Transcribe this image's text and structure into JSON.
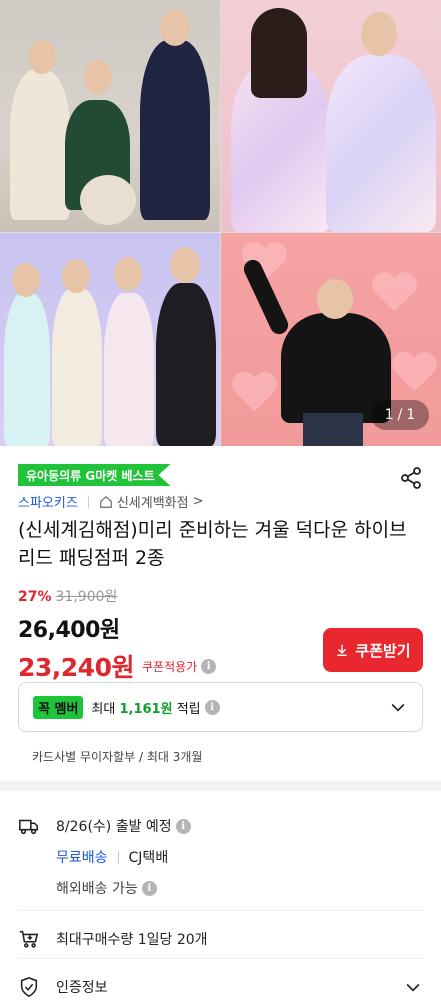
{
  "gallery": {
    "page_indicator": {
      "current": "1",
      "separator": "/",
      "total": "1"
    }
  },
  "badge": {
    "label": "유아동의류 G마켓 베스트"
  },
  "brand": {
    "name": "스파오키즈",
    "store": "신세계백화점",
    "store_arrow": ">"
  },
  "product": {
    "title": "(신세계김해점)미리 준비하는 겨울 덕다운 하이브리드 패딩점퍼 2종"
  },
  "price": {
    "discount": "27%",
    "original": "31,900원",
    "sale": "26,400원",
    "coupon_price": "23,240원",
    "coupon_label": "쿠폰적용가",
    "coupon_button": "쿠폰받기"
  },
  "member": {
    "badge": "꼭 멤버",
    "text_prefix": "최대 ",
    "amount": "1,161원",
    "text_suffix": " 적립"
  },
  "installment": {
    "text": "카드사별 무이자할부 / 최대 3개월"
  },
  "shipping": {
    "date": "8/26(수) 출발 예정",
    "free": "무료배송",
    "carrier": "CJ택배",
    "overseas": "해외배송 가능"
  },
  "purchase": {
    "max": "최대구매수량 1일당 20개"
  },
  "certification": {
    "label": "인증정보"
  },
  "colors": {
    "accent_red": "#e8272f",
    "brand_blue": "#1a57e6",
    "badge_green": "#20c33a"
  }
}
